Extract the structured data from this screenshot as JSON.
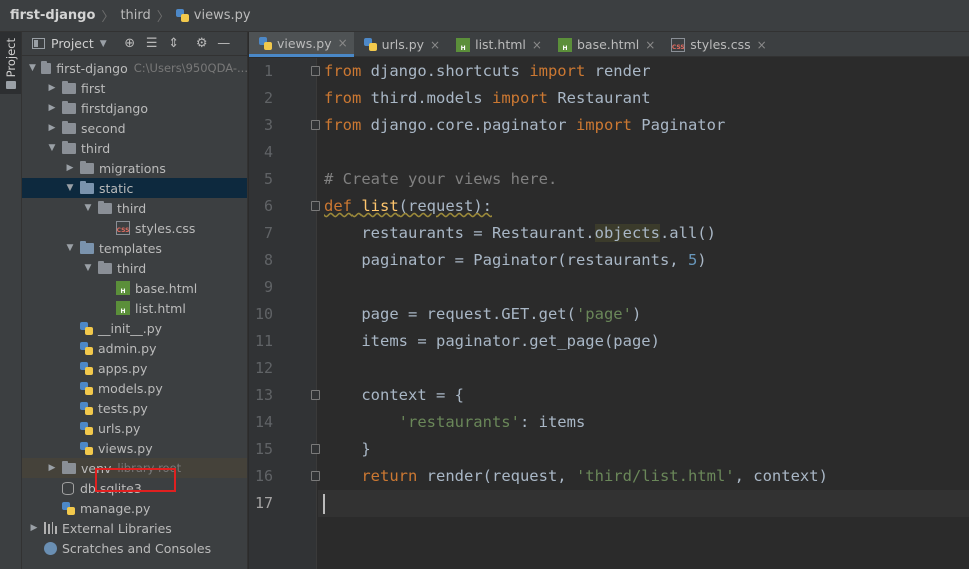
{
  "breadcrumb": [
    "first-django",
    "third",
    "views.py"
  ],
  "tool_strip": {
    "project_tab": "Project"
  },
  "project_panel": {
    "title": "Project",
    "tools": [
      "target-icon",
      "collapse-all-icon",
      "expand-icon",
      "gear-icon",
      "minimize-icon"
    ],
    "tree": [
      {
        "depth": 0,
        "arrow": "down",
        "icon": "folder-icon",
        "label": "first-django",
        "sub": "C:\\Users\\950QDA-..."
      },
      {
        "depth": 1,
        "arrow": "right",
        "icon": "folder-icon",
        "label": "first"
      },
      {
        "depth": 1,
        "arrow": "right",
        "icon": "folder-icon",
        "label": "firstdjango"
      },
      {
        "depth": 1,
        "arrow": "right",
        "icon": "folder-icon",
        "label": "second"
      },
      {
        "depth": 1,
        "arrow": "down",
        "icon": "folder-icon",
        "label": "third"
      },
      {
        "depth": 2,
        "arrow": "right",
        "icon": "folder-icon",
        "label": "migrations"
      },
      {
        "depth": 2,
        "arrow": "down",
        "icon": "folder-blue-icon",
        "label": "static",
        "selected": true
      },
      {
        "depth": 3,
        "arrow": "down",
        "icon": "folder-icon",
        "label": "third"
      },
      {
        "depth": 4,
        "arrow": "",
        "icon": "css-file-icon",
        "label": "styles.css"
      },
      {
        "depth": 2,
        "arrow": "down",
        "icon": "folder-blue-icon",
        "label": "templates"
      },
      {
        "depth": 3,
        "arrow": "down",
        "icon": "folder-icon",
        "label": "third"
      },
      {
        "depth": 4,
        "arrow": "",
        "icon": "html-file-icon",
        "label": "base.html"
      },
      {
        "depth": 4,
        "arrow": "",
        "icon": "html-file-icon",
        "label": "list.html"
      },
      {
        "depth": 2,
        "arrow": "",
        "icon": "python-file-icon",
        "label": "__init__.py"
      },
      {
        "depth": 2,
        "arrow": "",
        "icon": "python-file-icon",
        "label": "admin.py"
      },
      {
        "depth": 2,
        "arrow": "",
        "icon": "python-file-icon",
        "label": "apps.py"
      },
      {
        "depth": 2,
        "arrow": "",
        "icon": "python-file-icon",
        "label": "models.py"
      },
      {
        "depth": 2,
        "arrow": "",
        "icon": "python-file-icon",
        "label": "tests.py"
      },
      {
        "depth": 2,
        "arrow": "",
        "icon": "python-file-icon",
        "label": "urls.py"
      },
      {
        "depth": 2,
        "arrow": "",
        "icon": "python-file-icon",
        "label": "views.py",
        "boxed": true
      },
      {
        "depth": 1,
        "arrow": "right",
        "icon": "folder-icon",
        "label": "venv",
        "sub": "library root",
        "venv": true
      },
      {
        "depth": 1,
        "arrow": "",
        "icon": "database-icon",
        "label": "db.sqlite3"
      },
      {
        "depth": 1,
        "arrow": "",
        "icon": "python-file-icon",
        "label": "manage.py"
      },
      {
        "depth": 0,
        "arrow": "right",
        "icon": "library-icon",
        "label": "External Libraries"
      },
      {
        "depth": 0,
        "arrow": "",
        "icon": "scratches-icon",
        "label": "Scratches and Consoles"
      }
    ]
  },
  "tabs": [
    {
      "label": "views.py",
      "icon": "python-file-icon",
      "active": true
    },
    {
      "label": "urls.py",
      "icon": "python-file-icon",
      "active": false
    },
    {
      "label": "list.html",
      "icon": "html-file-icon",
      "active": false
    },
    {
      "label": "base.html",
      "icon": "html-file-icon",
      "active": false
    },
    {
      "label": "styles.css",
      "icon": "css-file-icon",
      "active": false
    }
  ],
  "editor": {
    "current_line": 17,
    "lines": [
      [
        [
          "kw",
          "from"
        ],
        [
          "plain",
          " django.shortcuts "
        ],
        [
          "kw",
          "import"
        ],
        [
          "plain",
          " render"
        ]
      ],
      [
        [
          "kw",
          "from"
        ],
        [
          "plain",
          " third.models "
        ],
        [
          "kw",
          "import"
        ],
        [
          "plain",
          " Restaurant"
        ]
      ],
      [
        [
          "kw",
          "from"
        ],
        [
          "plain",
          " django.core.paginator "
        ],
        [
          "kw",
          "import"
        ],
        [
          "plain",
          " Paginator"
        ]
      ],
      [],
      [
        [
          "cmt",
          "# Create your views here."
        ]
      ],
      [
        [
          "kw squig",
          "def"
        ],
        [
          "plain squig",
          " "
        ],
        [
          "fn squig",
          "list"
        ],
        [
          "plain squig",
          "(request):"
        ]
      ],
      [
        [
          "plain",
          "    restaurants = Restaurant."
        ],
        [
          "hl",
          "objects"
        ],
        [
          "plain",
          ".all()"
        ]
      ],
      [
        [
          "plain",
          "    paginator = Paginator(restaurants, "
        ],
        [
          "num",
          "5"
        ],
        [
          "plain",
          ")"
        ]
      ],
      [],
      [
        [
          "plain",
          "    page = request.GET.get("
        ],
        [
          "str",
          "'page'"
        ],
        [
          "plain",
          ")"
        ]
      ],
      [
        [
          "plain",
          "    items = paginator.get_page(page)"
        ]
      ],
      [],
      [
        [
          "plain",
          "    context = {"
        ]
      ],
      [
        [
          "plain",
          "        "
        ],
        [
          "str",
          "'restaurants'"
        ],
        [
          "plain",
          ": items"
        ]
      ],
      [
        [
          "plain",
          "    }"
        ]
      ],
      [
        [
          "kw",
          "    return"
        ],
        [
          "plain",
          " render(request, "
        ],
        [
          "str",
          "'third/list.html'"
        ],
        [
          "plain",
          ", context)"
        ]
      ],
      []
    ]
  },
  "colors": {
    "background": "#2b2b2b",
    "keyword": "#cc7832",
    "string": "#6a8759",
    "number": "#6897bb",
    "comment": "#808080",
    "function": "#ffc66d",
    "selection": "#0d293e",
    "highlight_box": "#e02020"
  }
}
